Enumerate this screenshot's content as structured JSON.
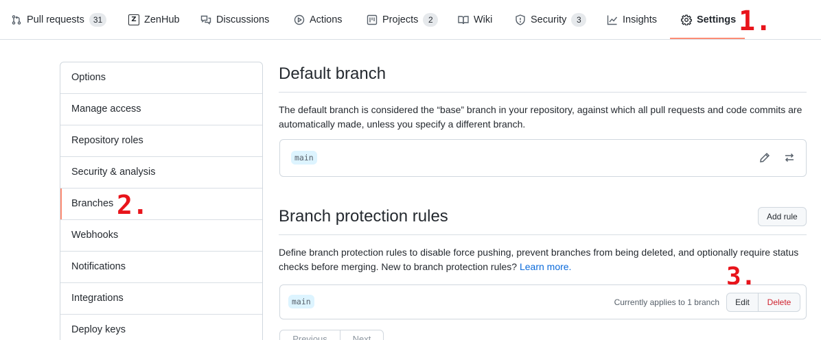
{
  "tabs": [
    {
      "label": "Pull requests",
      "count": "31",
      "icon": "git-pull-request-icon"
    },
    {
      "label": "ZenHub",
      "icon": "zenhub-icon",
      "glyph": "Z"
    },
    {
      "label": "Discussions",
      "icon": "comment-discussion-icon"
    },
    {
      "label": "Actions",
      "icon": "play-icon"
    },
    {
      "label": "Projects",
      "count": "2",
      "icon": "project-icon"
    },
    {
      "label": "Wiki",
      "icon": "book-icon"
    },
    {
      "label": "Security",
      "count": "3",
      "icon": "shield-icon"
    },
    {
      "label": "Insights",
      "icon": "graph-icon"
    },
    {
      "label": "Settings",
      "icon": "gear-icon",
      "selected": true
    }
  ],
  "annotations": {
    "step1": "1.",
    "step2": "2.",
    "step3": "3."
  },
  "sidebar": {
    "items": [
      {
        "label": "Options"
      },
      {
        "label": "Manage access"
      },
      {
        "label": "Repository roles"
      },
      {
        "label": "Security & analysis"
      },
      {
        "label": "Branches",
        "active": true
      },
      {
        "label": "Webhooks"
      },
      {
        "label": "Notifications"
      },
      {
        "label": "Integrations"
      },
      {
        "label": "Deploy keys"
      }
    ]
  },
  "default_branch": {
    "title": "Default branch",
    "description": "The default branch is considered the “base” branch in your repository, against which all pull requests and code commits are automatically made, unless you specify a different branch.",
    "branch_name": "main",
    "edit_icon": "pencil-icon",
    "switch_icon": "arrow-switch-icon"
  },
  "protection": {
    "title": "Branch protection rules",
    "add_rule_label": "Add rule",
    "description": "Define branch protection rules to disable force pushing, prevent branches from being deleted, and optionally require status checks before merging. New to branch protection rules? ",
    "learn_more": "Learn more.",
    "rule": {
      "branch": "main",
      "applies_text": "Currently applies to 1 branch",
      "edit_label": "Edit",
      "delete_label": "Delete"
    }
  },
  "pagination": {
    "previous": "Previous",
    "next": "Next"
  },
  "colors": {
    "accent_underline": "#fd8c73",
    "annotation_red": "#e8141b",
    "link": "#0969da",
    "delete": "#cf222e"
  }
}
